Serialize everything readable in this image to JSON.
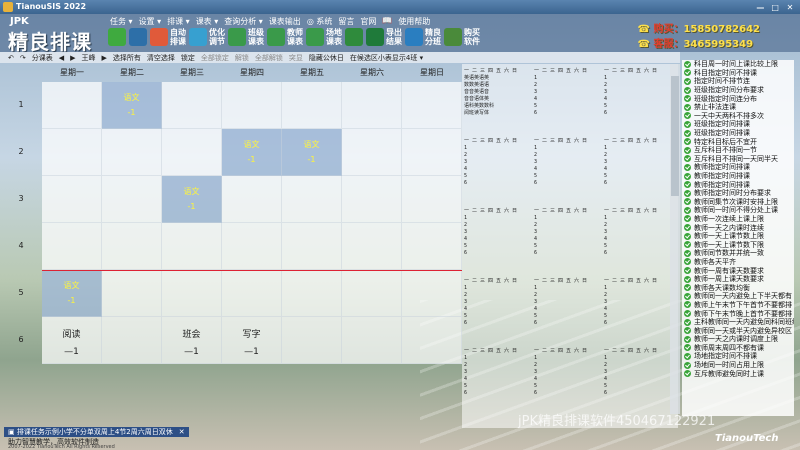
{
  "window": {
    "title": "TianouSIS 2022",
    "controls": [
      "—",
      "□",
      "✕"
    ]
  },
  "brand": {
    "small": "JPK",
    "big": "精良排课",
    "footer": "TianouTech"
  },
  "menu": [
    "任务 ▾",
    "设置 ▾",
    "排课 ▾",
    "课表 ▾",
    "查询分析 ▾",
    "课表输出",
    "◎ 系统",
    "留言",
    "官网",
    "📖",
    "使用帮助"
  ],
  "ribbon": [
    {
      "label": "",
      "icon": "add-icon",
      "color": "#3faa3f"
    },
    {
      "label": "",
      "icon": "import-icon",
      "color": "#2d6fa8"
    },
    {
      "label": "自动\n排课",
      "icon": "color-wheel-icon",
      "color": "#e05a3a"
    },
    {
      "label": "优化\n调节",
      "icon": "optimize-icon",
      "color": "#37a0d0"
    },
    {
      "label": "班级\n课表",
      "icon": "class-grid-icon",
      "color": "#3a9a4a"
    },
    {
      "label": "教师\n课表",
      "icon": "teacher-grid-icon",
      "color": "#3a9a4a"
    },
    {
      "label": "场地\n课表",
      "icon": "room-grid-icon",
      "color": "#3a9a4a"
    },
    {
      "label": "",
      "icon": "save-icon",
      "color": "#2f8b3c"
    },
    {
      "label": "导出\n结果",
      "icon": "excel-icon",
      "color": "#1f7a3a"
    },
    {
      "label": "精良\n分班",
      "icon": "globe-icon",
      "color": "#2a7ec0"
    },
    {
      "label": "购买\n软件",
      "icon": "money-bag-icon",
      "color": "#4a8a3a"
    }
  ],
  "contact": {
    "buy_label": "购买：",
    "buy_number": "15850782642",
    "service_label": "客服：",
    "service_number": "3465995349"
  },
  "toolbar2": [
    "↶",
    "↷",
    "分课表",
    "◀",
    "▶",
    "王峰",
    "▶",
    "选择所有",
    "清空选择",
    "锁定",
    "全部锁定",
    "解锁",
    "全部解锁",
    "突显",
    "隐藏公休日",
    "在候选区小表显示4班 ▾"
  ],
  "days": [
    "星期一",
    "星期二",
    "星期三",
    "星期四",
    "星期五",
    "星期六",
    "星期日"
  ],
  "periods": [
    "1",
    "2",
    "3",
    "4",
    "5",
    "6"
  ],
  "cells": [
    {
      "row": 0,
      "col": 1,
      "text": "语文",
      "num": "-1",
      "style": "hl"
    },
    {
      "row": 1,
      "col": 3,
      "text": "语文",
      "num": "-1",
      "style": "hl"
    },
    {
      "row": 1,
      "col": 4,
      "text": "语文",
      "num": "-1",
      "style": "hl"
    },
    {
      "row": 2,
      "col": 2,
      "text": "语文",
      "num": "-1",
      "style": "hl"
    },
    {
      "row": 4,
      "col": 0,
      "text": "语文",
      "num": "-1",
      "style": "hl"
    },
    {
      "row": 5,
      "col": 0,
      "text": "阅读",
      "num": "—1",
      "style": "dark"
    },
    {
      "row": 5,
      "col": 2,
      "text": "班会",
      "num": "—1",
      "style": "dark"
    },
    {
      "row": 5,
      "col": 3,
      "text": "写字",
      "num": "—1",
      "style": "dark"
    }
  ],
  "mini_header": "一 二 三 四 五 六 日",
  "mini_subjects": [
    "英语英语英",
    "数数英语语",
    "音音英语音",
    "音音语体英",
    "语科英数数科",
    "阅班读写体"
  ],
  "constraints": [
    "科目周一时间上课比较上限",
    "科目指定时间不排课",
    "指定时间不排节连",
    "班级指定时间分布要求",
    "班级指定时间连分布",
    "禁止非法连课",
    "一天中天两科不排多次",
    "班级指定时间排课",
    "班级指定时间排课",
    "特定科目标后不宜开",
    "互斥科目不排同一节",
    "互斥科目不排同一天同半天",
    "教师指定时间排课",
    "教师指定时间排课",
    "教师指定时间排课",
    "教师指定时间时分布要求",
    "教师同集节次课时安排上限",
    "教师同一时间不得分处上课",
    "教师一次连续上课上限",
    "教师一天之内课时连续",
    "教师一天上课节数上限",
    "教师一天上课节数下限",
    "教师同节数并并统一致",
    "教师各天平齐",
    "教师一周有课天数要求",
    "教师一周上课天数要求",
    "教师各天课数均衡",
    "教师同一天内避免上下半天都有",
    "教师上午末节下午首节不要都排",
    "教师下午末节晚上首节不要都排",
    "主科教师同一天内避免同科同班级",
    "教师同一天或半天内避免异校区",
    "教师一天之内课时调度上限",
    "教师周末周四不都有课",
    "场地指定时间不排课",
    "场地同一时间占用上限",
    "互斥教师避免同时上课"
  ],
  "bottom_tab": "▣ 排课任务示例小学不分单双周上4节2周六周日双休",
  "status": "助力智慧教学，高效软件制造",
  "copyright": "2007-2022 TianouTech All Rights Reserved",
  "watermark": "jPK精良排课软件450467122921"
}
